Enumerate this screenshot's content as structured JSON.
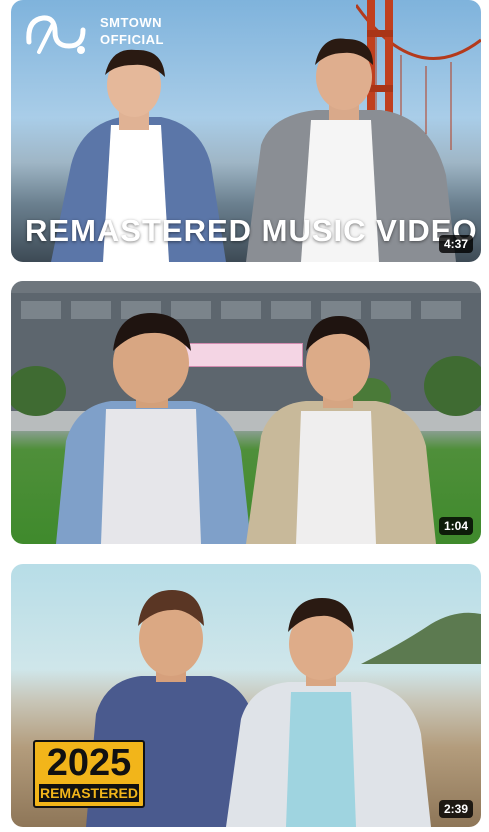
{
  "videos": [
    {
      "channel_logo_text": "SMTOWN\nOFFICIAL",
      "channel_line1": "SMTOWN",
      "channel_line2": "OFFICIAL",
      "overlay_title": "REMASTERED MUSIC VIDEO",
      "duration": "4:37"
    },
    {
      "duration": "1:04"
    },
    {
      "badge_year": "2025",
      "badge_label": "REMASTERED",
      "duration": "2:39"
    }
  ],
  "colors": {
    "duration_bg": "#000000",
    "badge_yellow": "#f2b51a",
    "bridge_red": "#c0401f"
  },
  "icons": {
    "channel_logo": "smtown-logo-icon"
  }
}
